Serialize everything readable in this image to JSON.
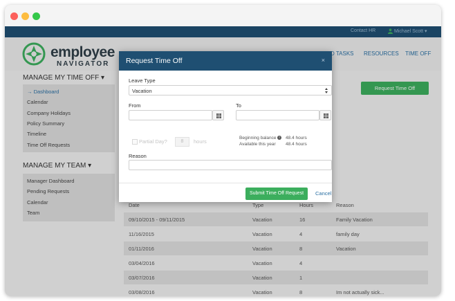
{
  "topbar": {
    "contact": "Contact HR",
    "user": "Michael Scott ▾"
  },
  "logo": {
    "word": "employee",
    "sub": "NAVIGATOR"
  },
  "nav": {
    "visible_suffix": "D TASKS",
    "resources": "RESOURCES",
    "time_off": "TIME OFF"
  },
  "sidebar": {
    "time_off_title": "MANAGE MY TIME OFF ▾",
    "time_off_items": [
      "→ Dashboard",
      "Calendar",
      "Company Holidays",
      "Policy Summary",
      "Timeline",
      "Time Off Requests"
    ],
    "team_title": "MANAGE MY TEAM ▾",
    "team_items": [
      "Manager Dashboard",
      "Pending Requests",
      "Calendar",
      "Team"
    ]
  },
  "request_button": "Request Time Off",
  "table": {
    "headers": [
      "Date",
      "Type",
      "Hours",
      "Reason"
    ],
    "rows": [
      [
        "09/10/2015 - 09/11/2015",
        "Vacation",
        "16",
        "Family Vacation"
      ],
      [
        "11/16/2015",
        "Vacation",
        "4",
        "family day"
      ],
      [
        "01/11/2016",
        "Vacation",
        "8",
        "Vacation"
      ],
      [
        "03/04/2016",
        "Vacation",
        "4",
        ""
      ],
      [
        "03/07/2016",
        "Vacation",
        "1",
        ""
      ],
      [
        "03/08/2016",
        "Vacation",
        "8",
        "Im not actually sick..."
      ]
    ]
  },
  "modal": {
    "title": "Request Time Off",
    "close": "×",
    "leave_type_label": "Leave Type",
    "leave_type_value": "Vacation",
    "from_label": "From",
    "to_label": "To",
    "partial_day_label": "Partial Day?",
    "hours_value": "8",
    "hours_label": "hours",
    "beginning_balance_label": "Beginning balance",
    "beginning_balance_value": "48.4 hours",
    "available_label": "Available this year",
    "available_value": "48.4 hours",
    "reason_label": "Reason",
    "submit": "Submit Time Off Request",
    "cancel": "Cancel"
  },
  "colors": {
    "navy": "#1f4f72",
    "green": "#3cae5d",
    "link": "#2a6fa3"
  }
}
